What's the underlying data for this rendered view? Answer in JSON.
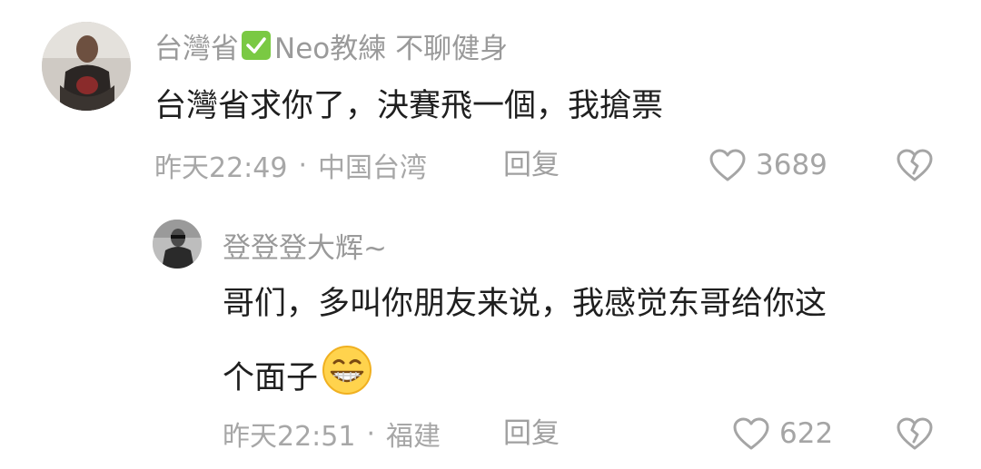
{
  "comments": [
    {
      "username_part1": "台灣省",
      "username_part2": "Neo教練 不聊健身",
      "badge_icon": "check-mark-icon",
      "text": "台灣省求你了，決賽飛一個，我搶票",
      "time": "昨天22:49",
      "separator": "·",
      "location": "中国台湾",
      "reply_label": "回复",
      "likes": "3689"
    },
    {
      "username": "登登登大辉~",
      "text_line1": "哥们，多叫你朋友来说，我感觉东哥给你这",
      "text_line2": "个面子",
      "emoji_icon": "grinning-face-emoji",
      "time": "昨天22:51",
      "separator": "·",
      "location": "福建",
      "reply_label": "回复",
      "likes": "622"
    }
  ],
  "colors": {
    "username": "#9a9a9a",
    "text": "#1f1f1f",
    "meta": "#a7a7a7",
    "badge": "#7ac943"
  }
}
